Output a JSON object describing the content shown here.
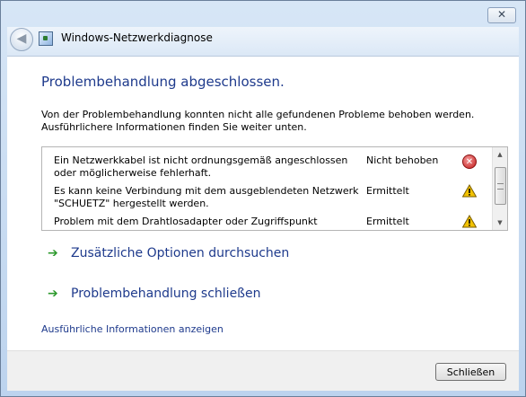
{
  "window": {
    "close_glyph": "✕",
    "title": "Windows-Netzwerkdiagnose"
  },
  "header": {
    "back_glyph": "◀"
  },
  "main": {
    "heading": "Problembehandlung abgeschlossen.",
    "description_lines": [
      "Von der Problembehandlung konnten nicht alle gefundenen Probleme behoben werden.",
      "Ausführlichere Informationen finden Sie weiter unten."
    ],
    "problems": [
      {
        "lines": [
          "Ein Netzwerkkabel ist nicht ordnungsgemäß angeschlossen",
          "oder möglicherweise fehlerhaft."
        ],
        "status": "Nicht behoben",
        "icon": "error-icon"
      },
      {
        "lines": [
          "Es kann keine Verbindung mit dem ausgeblendeten Netzwerk",
          "\"SCHUETZ\" hergestellt werden."
        ],
        "status": "Ermittelt",
        "icon": "warning-icon"
      },
      {
        "lines": [
          "Problem mit dem Drahtlosadapter oder Zugriffspunkt"
        ],
        "status": "Ermittelt",
        "icon": "warning-icon"
      }
    ],
    "options": [
      {
        "label": "Zusätzliche Optionen durchsuchen"
      },
      {
        "label": "Problembehandlung schließen"
      }
    ],
    "details_link": "Ausführliche Informationen anzeigen"
  },
  "footer": {
    "close_label": "Schließen"
  },
  "colors": {
    "heading": "#1e3a8c",
    "link": "#1e3a8c",
    "arrow": "#2e9a2e",
    "error": "#c21a1a",
    "warning": "#f2c200"
  }
}
